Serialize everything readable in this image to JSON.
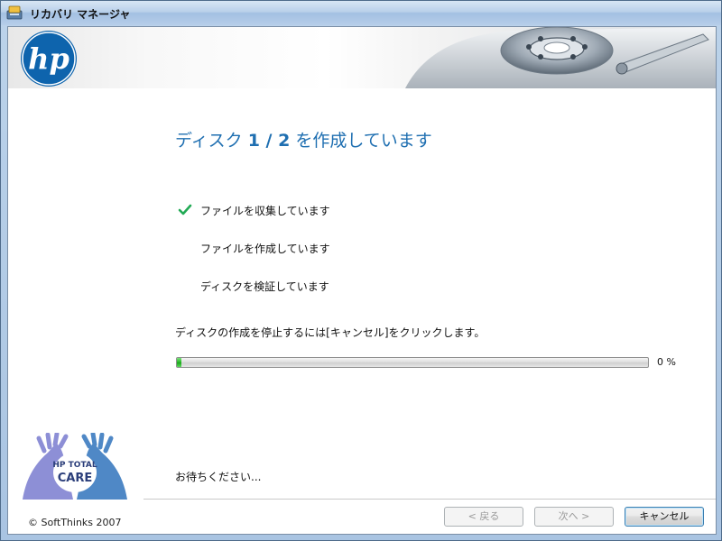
{
  "window": {
    "title": "リカバリ マネージャ"
  },
  "header": {
    "logo_text": "hp"
  },
  "main": {
    "heading_prefix": "ディスク ",
    "heading_disc": "1 / 2",
    "heading_suffix": " を作成しています",
    "steps": [
      {
        "label": "ファイルを収集しています",
        "done": true
      },
      {
        "label": "ファイルを作成しています",
        "done": false
      },
      {
        "label": "ディスクを検証しています",
        "done": false
      }
    ],
    "info": "ディスクの作成を停止するには[キャンセル]をクリックします。",
    "progress": {
      "percent": 0.01,
      "label": "0 %"
    },
    "wait_text": "お待ちください..."
  },
  "sidebar": {
    "care_logo_line1": "HP TOTAL",
    "care_logo_line2": "CARE",
    "copyright": "© SoftThinks 2007"
  },
  "footer": {
    "back_label": "< 戻る",
    "next_label": "次へ >",
    "cancel_label": "キャンセル"
  },
  "colors": {
    "accent": "#1f6fb1",
    "check": "#22aa55",
    "progress": "#24b524"
  },
  "icons": {
    "app": "recovery-manager-icon",
    "done_step": "checkmark-icon"
  }
}
